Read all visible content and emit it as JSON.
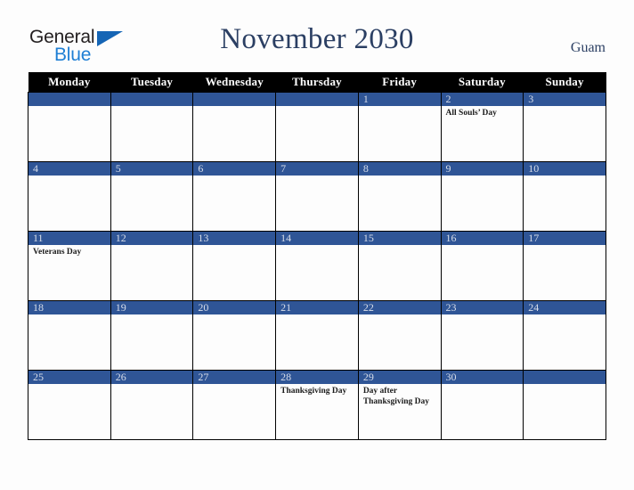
{
  "brand": {
    "name_part1": "General",
    "name_part2": "Blue",
    "accent_color": "#1565b5",
    "text_color": "#231f20"
  },
  "header": {
    "title": "November 2030",
    "month": "November",
    "year": "2030",
    "region": "Guam",
    "title_color": "#2b3f63"
  },
  "colors": {
    "day_band": "#2f5596",
    "weekday_header_bg": "#000000",
    "weekday_header_text": "#ffffff",
    "grid_line": "#000000",
    "page_background": "#fdfdfd"
  },
  "weekdays": [
    "Monday",
    "Tuesday",
    "Wednesday",
    "Thursday",
    "Friday",
    "Saturday",
    "Sunday"
  ],
  "weeks": [
    [
      {
        "day": "",
        "events": []
      },
      {
        "day": "",
        "events": []
      },
      {
        "day": "",
        "events": []
      },
      {
        "day": "",
        "events": []
      },
      {
        "day": "1",
        "events": []
      },
      {
        "day": "2",
        "events": [
          "All Souls’ Day"
        ]
      },
      {
        "day": "3",
        "events": []
      }
    ],
    [
      {
        "day": "4",
        "events": []
      },
      {
        "day": "5",
        "events": []
      },
      {
        "day": "6",
        "events": []
      },
      {
        "day": "7",
        "events": []
      },
      {
        "day": "8",
        "events": []
      },
      {
        "day": "9",
        "events": []
      },
      {
        "day": "10",
        "events": []
      }
    ],
    [
      {
        "day": "11",
        "events": [
          "Veterans Day"
        ]
      },
      {
        "day": "12",
        "events": []
      },
      {
        "day": "13",
        "events": []
      },
      {
        "day": "14",
        "events": []
      },
      {
        "day": "15",
        "events": []
      },
      {
        "day": "16",
        "events": []
      },
      {
        "day": "17",
        "events": []
      }
    ],
    [
      {
        "day": "18",
        "events": []
      },
      {
        "day": "19",
        "events": []
      },
      {
        "day": "20",
        "events": []
      },
      {
        "day": "21",
        "events": []
      },
      {
        "day": "22",
        "events": []
      },
      {
        "day": "23",
        "events": []
      },
      {
        "day": "24",
        "events": []
      }
    ],
    [
      {
        "day": "25",
        "events": []
      },
      {
        "day": "26",
        "events": []
      },
      {
        "day": "27",
        "events": []
      },
      {
        "day": "28",
        "events": [
          "Thanksgiving Day"
        ]
      },
      {
        "day": "29",
        "events": [
          "Day after Thanksgiving Day"
        ]
      },
      {
        "day": "30",
        "events": []
      },
      {
        "day": "",
        "events": []
      }
    ]
  ]
}
